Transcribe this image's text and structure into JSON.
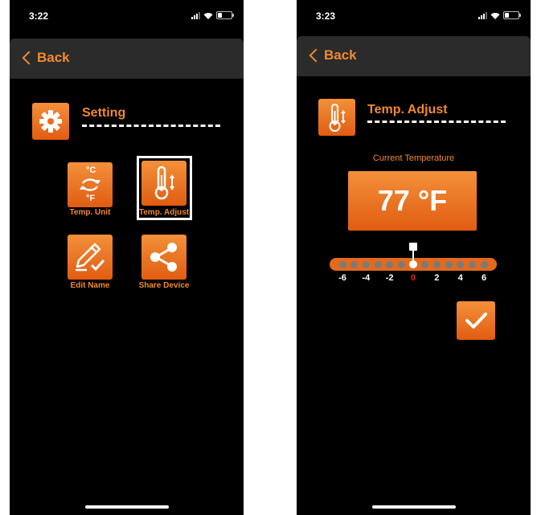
{
  "left": {
    "status_time": "3:22",
    "back_label": "Back",
    "header_title": "Setting",
    "tiles": [
      {
        "label": "Temp. Unit",
        "icon": "celsius-fahrenheit-swap-icon"
      },
      {
        "label": "Temp. Adjust",
        "icon": "thermometer-adjust-icon",
        "selected": true
      },
      {
        "label": "Edit Name",
        "icon": "pencil-check-icon"
      },
      {
        "label": "Share Device",
        "icon": "share-icon"
      }
    ],
    "tile_glyph_c": "°C",
    "tile_glyph_f": "°F"
  },
  "right": {
    "status_time": "3:23",
    "back_label": "Back",
    "header_title": "Temp. Adjust",
    "current_label": "Current Temperature",
    "temperature": "77 °F",
    "offset_ticks": [
      "-6",
      "-4",
      "-2",
      "0",
      "2",
      "4",
      "6"
    ],
    "selected_offset": 0,
    "offset_range": [
      -6,
      6
    ]
  },
  "colors": {
    "accent": "#f0892f",
    "background": "#000000",
    "navbar": "#2b2b2b",
    "zero_tick": "#e02020"
  }
}
